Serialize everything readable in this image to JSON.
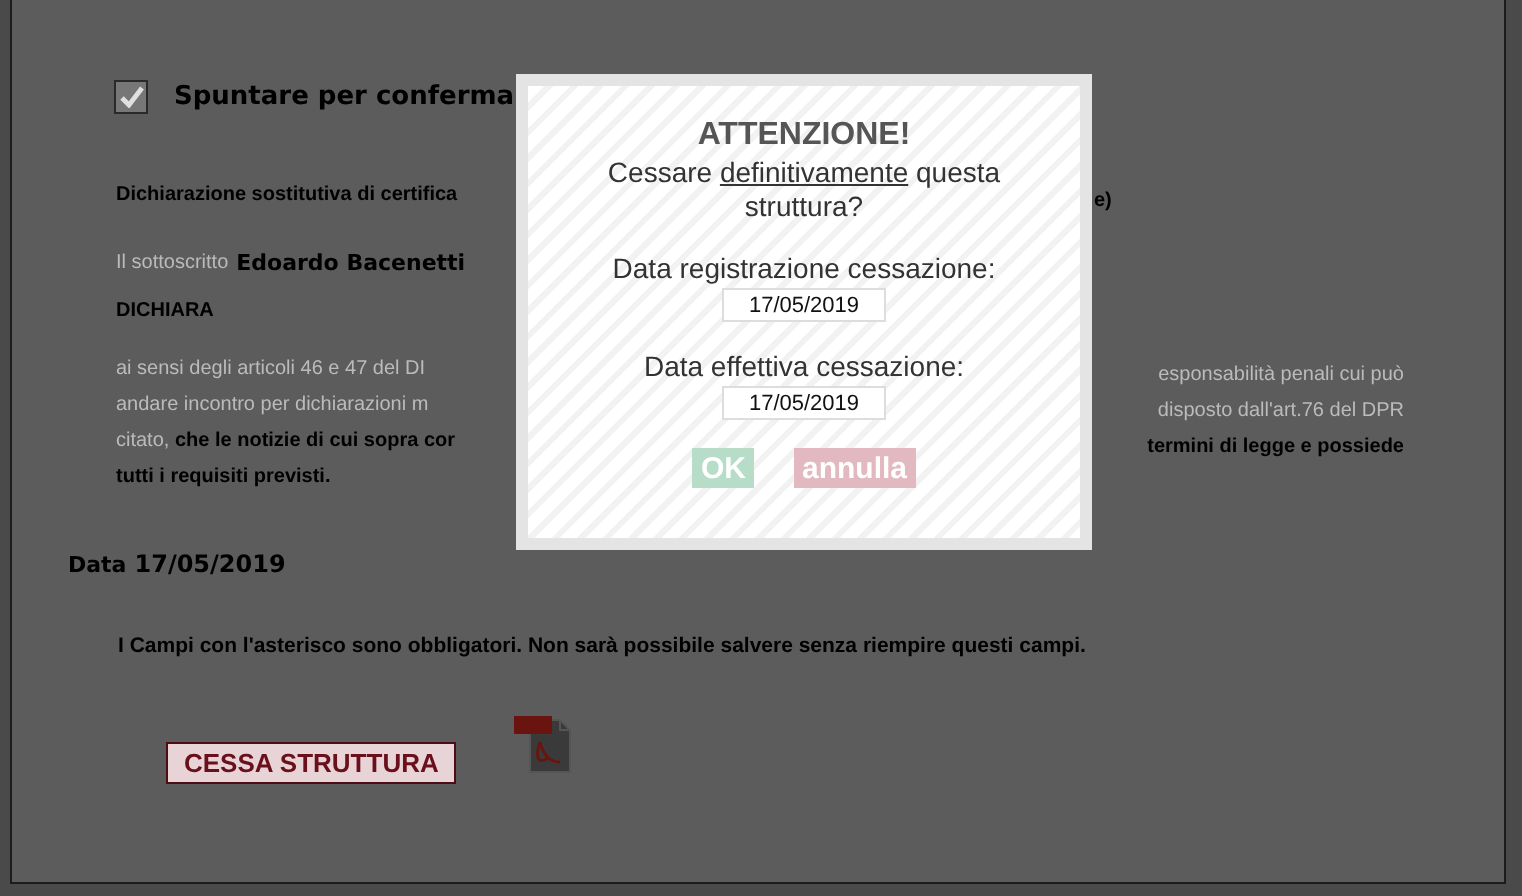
{
  "form": {
    "confirm": {
      "label": "Spuntare per conferma",
      "checked": true
    },
    "declaration_title": {
      "left": "Dichiarazione sostitutiva di certifica",
      "right": "e)"
    },
    "signer": {
      "label": "Il sottoscritto",
      "name": "Edoardo Bacenetti"
    },
    "heading": "DICHIARA",
    "paragraph_lines": [
      {
        "left": "ai sensi degli articoli 46 e 47 del DI",
        "right": "esponsabilità penali cui può",
        "bold": false
      },
      {
        "left": "andare incontro per dichiarazioni m",
        "right": "disposto dall'art.76 del DPR",
        "bold": false
      },
      {
        "left_plain": "citato, ",
        "left": "che le notizie di cui sopra cor",
        "right": "termini di legge e possiede",
        "bold": true
      },
      {
        "left": "tutti i requisiti previsti.",
        "bold": true
      }
    ],
    "date": {
      "label": "Data",
      "value": "17/05/2019"
    },
    "note": "I Campi con l'asterisco sono obbligatori. Non sarà possibile salvere senza riempire questi campi.",
    "submit": "CESSA STRUTTURA"
  },
  "dialog": {
    "title": "ATTENZIONE!",
    "question": [
      {
        "text": "Cessare ",
        "underline": false
      },
      {
        "text": "definitivamente",
        "underline": true
      },
      {
        "text": " questa struttura?",
        "underline": false
      }
    ],
    "fields": [
      {
        "label": "Data registrazione cessazione:",
        "value": "17/05/2019"
      },
      {
        "label": "Data effettiva cessazione:",
        "value": "17/05/2019"
      }
    ],
    "buttons": [
      {
        "label": "OK",
        "kind": "confirm"
      },
      {
        "label": "annulla",
        "kind": "cancel"
      }
    ]
  }
}
